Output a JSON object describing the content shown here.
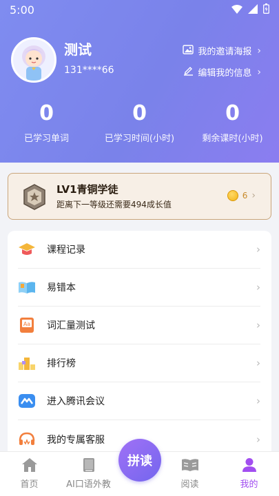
{
  "status_bar": {
    "time": "5:00"
  },
  "profile": {
    "name": "测试",
    "phone": "131****66",
    "invite_poster_label": "我的邀请海报",
    "edit_info_label": "编辑我的信息"
  },
  "stats": [
    {
      "value": "0",
      "label": "已学习单词"
    },
    {
      "value": "0",
      "label": "已学习时间(小时)"
    },
    {
      "value": "0",
      "label": "剩余课时(小时)"
    }
  ],
  "level": {
    "title": "LV1青铜学徒",
    "subtitle": "距离下一等级还需要494成长值",
    "coins": "6"
  },
  "menu": [
    {
      "label": "课程记录",
      "icon": "graduation-cap-icon"
    },
    {
      "label": "易错本",
      "icon": "open-book-icon"
    },
    {
      "label": "词汇量测试",
      "icon": "aa-test-icon"
    },
    {
      "label": "排行榜",
      "icon": "ranking-blocks-icon"
    },
    {
      "label": "进入腾讯会议",
      "icon": "tencent-meeting-icon"
    },
    {
      "label": "我的专属客服",
      "icon": "headset-icon"
    }
  ],
  "tabs": {
    "home": "首页",
    "ai_tutor": "AI口语外教",
    "center": "拼读",
    "reading": "阅读",
    "mine": "我的"
  },
  "colors": {
    "header_gradient_start": "#7f8cf0",
    "header_gradient_end": "#8b7df0",
    "active_tab": "#a24ef0",
    "level_card_bg": "#f7efe6",
    "level_card_border": "#c9a57a"
  }
}
